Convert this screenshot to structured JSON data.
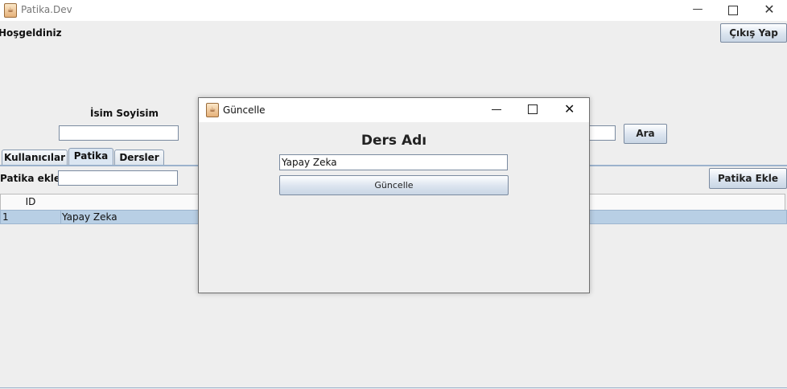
{
  "window": {
    "title": "Patika.Dev",
    "icon": "java-cup-icon",
    "controls": [
      "minimize-icon",
      "maximize-icon",
      "close-icon"
    ]
  },
  "header": {
    "welcome": "Hoşgeldiniz",
    "logout_label": "Çıkış Yap"
  },
  "search": {
    "name_label": "İsim Soyisim",
    "name_value": "",
    "search_button": "Ara"
  },
  "tabs": [
    {
      "label": "Kullanıcılar",
      "active": false
    },
    {
      "label": "Patika",
      "active": true
    },
    {
      "label": "Dersler",
      "active": false
    }
  ],
  "patika_panel": {
    "add_label": "Patika ekle",
    "add_value": "",
    "add_button": "Patika Ekle",
    "table": {
      "columns": [
        "ID",
        ""
      ],
      "rows": [
        {
          "id": "1",
          "name": "Yapay Zeka",
          "selected": true
        }
      ]
    }
  },
  "dialog": {
    "title": "Güncelle",
    "heading": "Ders Adı",
    "field_value": "Yapay Zeka",
    "submit_label": "Güncelle"
  },
  "colors": {
    "background": "#eeeeee",
    "selection": "#b8cfe5",
    "tab_underline": "#9bb2cc"
  }
}
